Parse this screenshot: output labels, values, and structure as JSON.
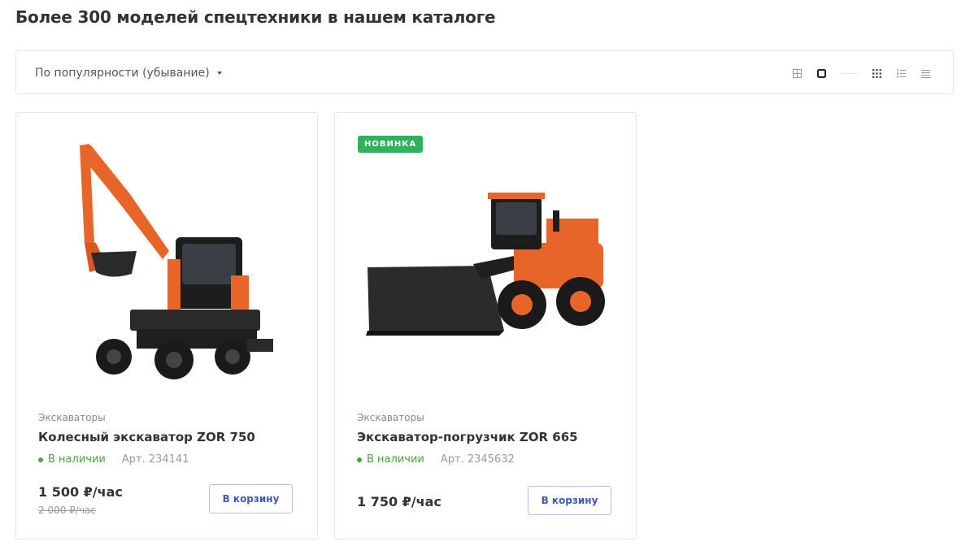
{
  "page": {
    "title": "Более 300 моделей спецтехники в нашем каталоге"
  },
  "toolbar": {
    "sort_label": "По популярности (убывание)",
    "view_modes": [
      "grid-small-icon",
      "grid-large-icon",
      "grid-dense-icon",
      "list-icon",
      "table-icon"
    ],
    "active_view": "grid-large-icon"
  },
  "products": [
    {
      "category": "Экскаваторы",
      "name": "Колесный экскаватор ZOR 750",
      "stock": "В наличии",
      "sku": "Арт. 234141",
      "price": "1 500 ₽/час",
      "old_price": "2 000 ₽/час",
      "cart_label": "В корзину",
      "image": "wheeled-excavator-image"
    },
    {
      "badge": "НОВИНКА",
      "category": "Экскаваторы",
      "name": "Экскаватор-погрузчик ZOR 665",
      "stock": "В наличии",
      "sku": "Арт. 2345632",
      "price": "1 750 ₽/час",
      "cart_label": "В корзину",
      "image": "wheel-loader-image"
    }
  ],
  "colors": {
    "accent": "#3c5ab8",
    "in_stock": "#4aa33a",
    "badge": "#2fb25a",
    "machine": "#e8652a"
  }
}
